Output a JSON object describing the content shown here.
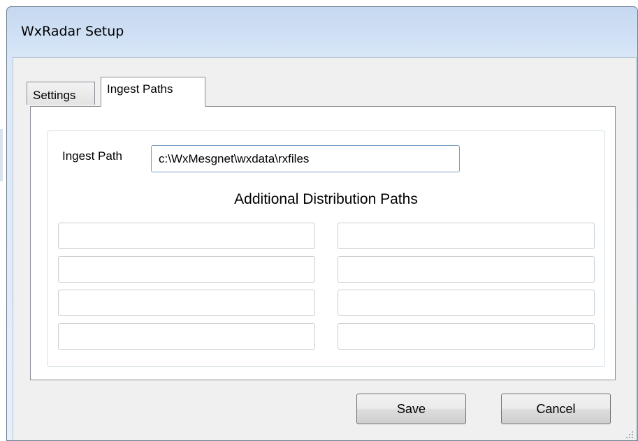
{
  "window": {
    "title": "WxRadar Setup"
  },
  "tabs": [
    {
      "label": "Settings",
      "selected": false
    },
    {
      "label": "Ingest Paths",
      "selected": true
    }
  ],
  "ingest": {
    "label": "Ingest Path",
    "value": "c:\\WxMesgnet\\wxdata\\rxfiles"
  },
  "additional": {
    "title": "Additional Distribution Paths",
    "left": [
      "",
      "",
      "",
      ""
    ],
    "right": [
      "",
      "",
      "",
      ""
    ]
  },
  "buttons": {
    "save": "Save",
    "cancel": "Cancel"
  },
  "colors": {
    "title_bar": "#c6d8ef",
    "client_bg": "#f0f0f0",
    "focus_border": "#7a9cc3"
  }
}
